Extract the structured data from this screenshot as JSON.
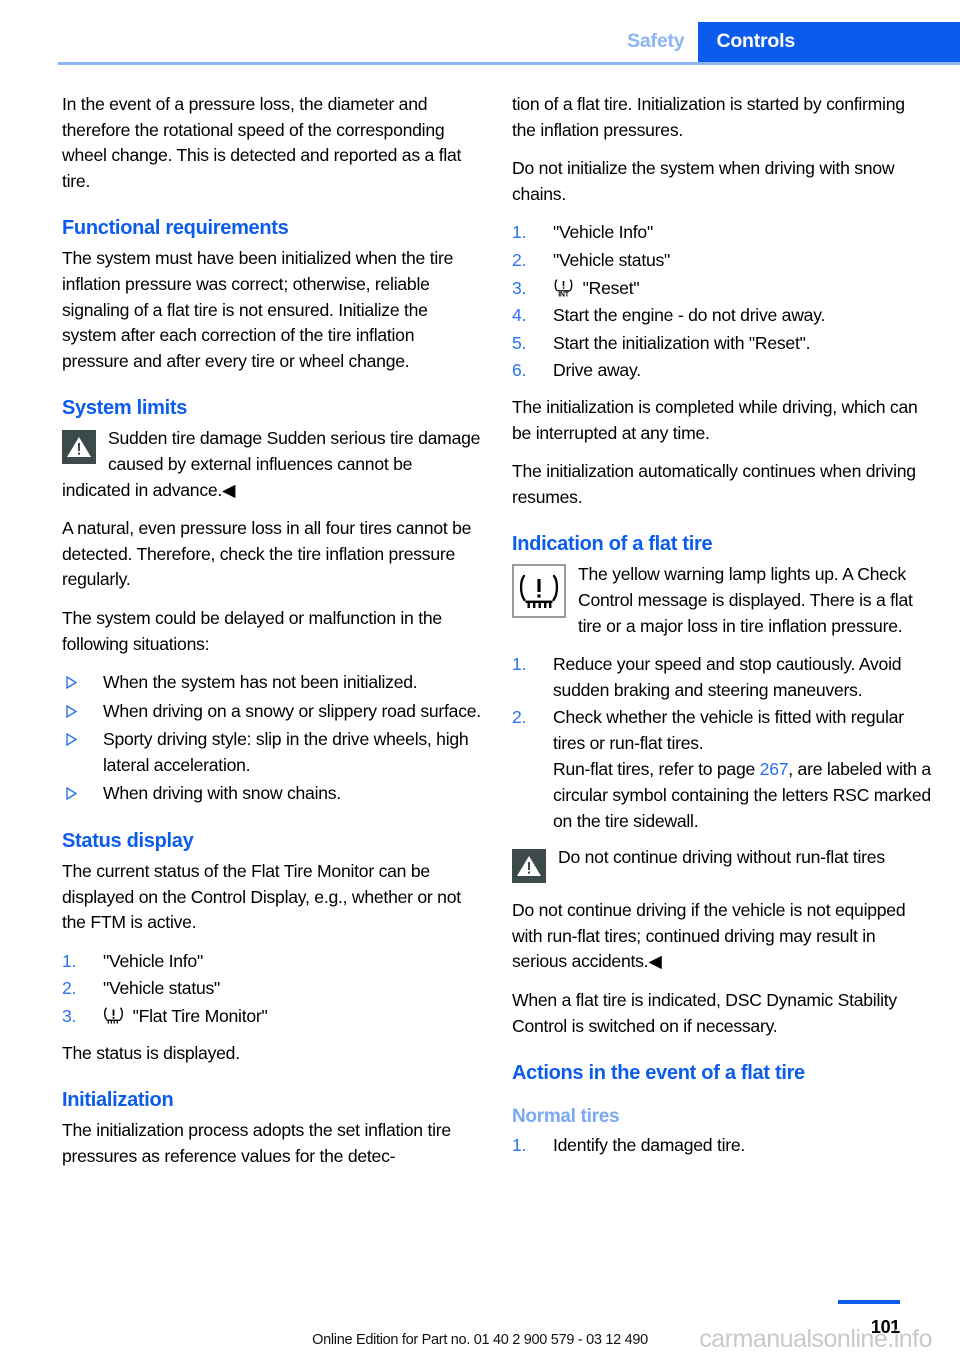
{
  "header": {
    "tab_inactive": "Safety",
    "tab_active": "Controls",
    "accent_blue": "#0b5ced",
    "light_blue": "#8db4f5"
  },
  "left_column": {
    "intro_paragraph": "In the event of a pressure loss, the diameter and therefore the rotational speed of the corresponding wheel change. This is detected and reported as a flat tire.",
    "functional_requirements": {
      "heading": "Functional requirements",
      "paragraph": "The system must have been initialized when the tire inflation pressure was correct; otherwise, reliable signaling of a flat tire is not ensured. Initialize the system after each correction of the tire inflation pressure and after every tire or wheel change."
    },
    "system_limits": {
      "heading": "System limits",
      "warning_title": "Sudden tire damage",
      "warning_text": "Sudden serious tire damage caused by external influences cannot be indicated in advance.◀",
      "paragraph_1": "A natural, even pressure loss in all four tires cannot be detected. Therefore, check the tire inflation pressure regularly.",
      "paragraph_2": "The system could be delayed or malfunction in the following situations:",
      "bullets": [
        "When the system has not been initialized.",
        "When driving on a snowy or slippery road surface.",
        "Sporty driving style: slip in the drive wheels, high lateral acceleration.",
        "When driving with snow chains."
      ]
    },
    "status_display": {
      "heading": "Status display",
      "paragraph": "The current status of the Flat Tire Monitor can be displayed on the Control Display, e.g., whether or not the FTM is active.",
      "steps": [
        {
          "num": "1.",
          "text": "\"Vehicle Info\"",
          "icon": null
        },
        {
          "num": "2.",
          "text": "\"Vehicle status\"",
          "icon": null
        },
        {
          "num": "3.",
          "text": "\"Flat Tire Monitor\"",
          "icon": "tpms-icon"
        }
      ],
      "closing": "The status is displayed."
    },
    "initialization": {
      "heading": "Initialization",
      "paragraph": "The initialization process adopts the set inflation tire pressures as reference values for the detec-"
    }
  },
  "right_column": {
    "continued_paragraph": "tion of a flat tire. Initialization is started by confirming the inflation pressures.",
    "snow_chains_paragraph": "Do not initialize the system when driving with snow chains.",
    "init_steps": [
      {
        "num": "1.",
        "text": "\"Vehicle Info\"",
        "icon": null
      },
      {
        "num": "2.",
        "text": "\"Vehicle status\"",
        "icon": null
      },
      {
        "num": "3.",
        "text": "\"Reset\"",
        "icon": "tpms-int-icon"
      },
      {
        "num": "4.",
        "text": "Start the engine - do not drive away.",
        "icon": null
      },
      {
        "num": "5.",
        "text": "Start the initialization with \"Reset\".",
        "icon": null
      },
      {
        "num": "6.",
        "text": "Drive away.",
        "icon": null
      }
    ],
    "init_closing_1": "The initialization is completed while driving, which can be interrupted at any time.",
    "init_closing_2": "The initialization automatically continues when driving resumes.",
    "indication": {
      "heading": "Indication of a flat tire",
      "lamp_text": "The yellow warning lamp lights up. A Check Control message is displayed.",
      "lamp_text_2": "There is a flat tire or a major loss in tire inflation pressure.",
      "steps": [
        {
          "num": "1.",
          "text": "Reduce your speed and stop cautiously. Avoid sudden braking and steering maneuvers.",
          "sub": null
        },
        {
          "num": "2.",
          "text": "Check whether the vehicle is fitted with regular tires or run-flat tires.",
          "sub_prefix": "Run-flat tires, refer to page ",
          "sub_pageref": "267",
          "sub_suffix": ", are labeled with a circular symbol containing the letters RSC marked on the tire sidewall."
        }
      ],
      "warning_title": "Do not continue driving without run-flat tires",
      "warning_text": "Do not continue driving if the vehicle is not equipped with run-flat tires; continued driving may result in serious accidents.◀",
      "dsc_paragraph": "When a flat tire is indicated, DSC Dynamic Stability Control is switched on if necessary."
    },
    "actions": {
      "heading": "Actions in the event of a flat tire",
      "subheading": "Normal tires",
      "steps": [
        {
          "num": "1.",
          "text": "Identify the damaged tire."
        }
      ]
    }
  },
  "footer": {
    "edition": "Online Edition for Part no. 01 40 2 900 579 - 03 12 490",
    "page_number": "101",
    "watermark": "carmanualsonline.info"
  }
}
